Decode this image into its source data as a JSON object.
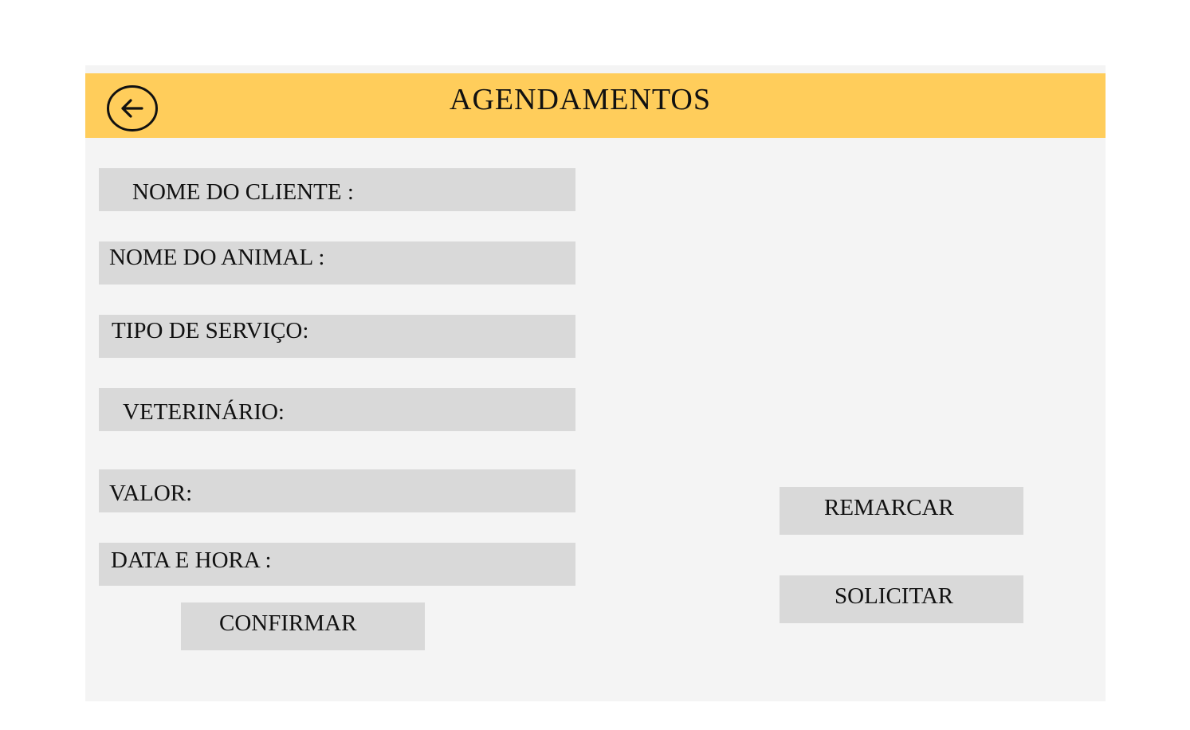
{
  "header": {
    "title": "AGENDAMENTOS",
    "back_icon": "arrow-left-circle-icon",
    "color": "#ffcd5b"
  },
  "form": {
    "fields": [
      {
        "label": "NOME DO CLIENTE :",
        "value": ""
      },
      {
        "label": "NOME DO ANIMAL :",
        "value": ""
      },
      {
        "label": "TIPO DE SERVIÇO:",
        "value": ""
      },
      {
        "label": "VETERINÁRIO:",
        "value": ""
      },
      {
        "label": "VALOR:",
        "value": ""
      },
      {
        "label": "DATA E HORA :",
        "value": ""
      }
    ],
    "confirm_label": "CONFIRMAR"
  },
  "actions": {
    "reschedule_label": "REMARCAR",
    "request_label": "SOLICITAR"
  },
  "colors": {
    "panel_background": "#f4f4f4",
    "field_background": "#d9d9d9"
  }
}
